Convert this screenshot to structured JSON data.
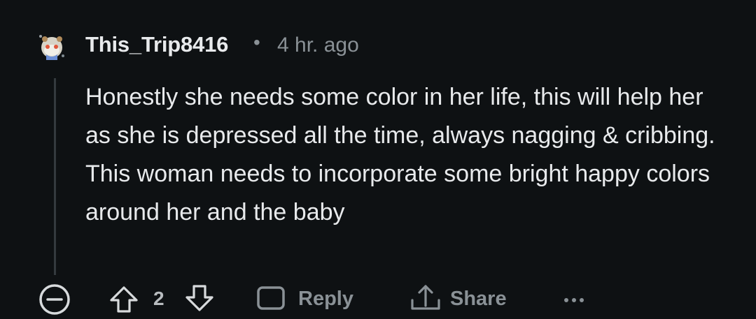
{
  "comment": {
    "author": "This_Trip8416",
    "separator": "•",
    "timestamp": "4 hr. ago",
    "body": "Honestly she needs some color in her life, this will help her as she is depressed all the time, always nagging & cribbing. This woman needs to incorporate some bright happy colors around her and the baby",
    "avatar_icon": "snoo-avatar-icon"
  },
  "actions": {
    "score": "2",
    "reply_label": "Reply",
    "share_label": "Share",
    "collapse_icon": "minus-circle-icon",
    "upvote_icon": "arrow-up-icon",
    "downvote_icon": "arrow-down-icon",
    "reply_icon": "speech-bubble-icon",
    "share_icon": "share-arrow-icon",
    "more_icon": "ellipsis-icon"
  },
  "colors": {
    "background": "#0e1113",
    "text": "#e8eaec",
    "muted": "#8a9196",
    "thread_line": "#343a3e"
  }
}
